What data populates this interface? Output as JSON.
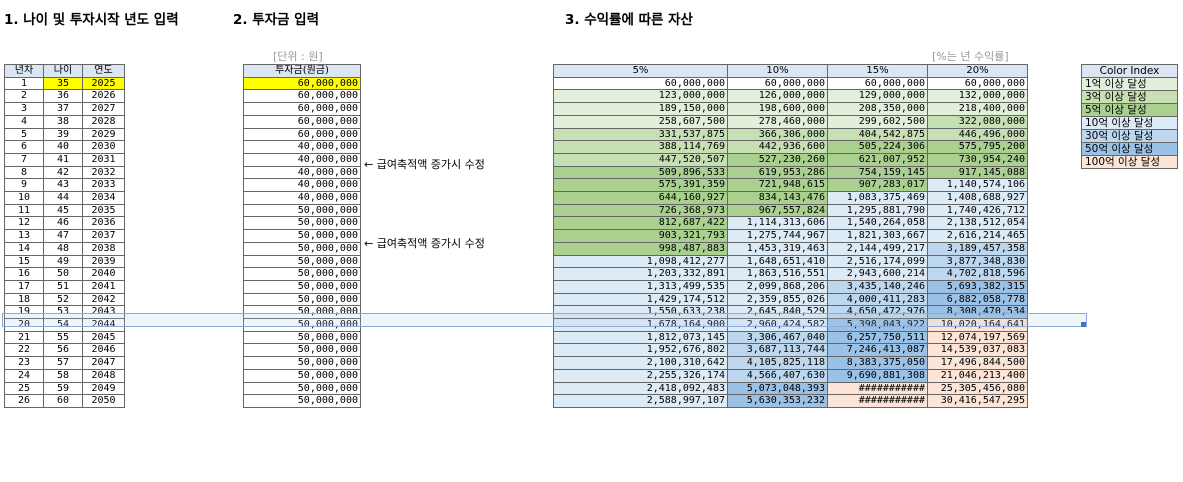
{
  "titles": {
    "section1": "1. 나이 및 투자시작 년도 입력",
    "section2": "2. 투자금 입력",
    "section3": "3. 수익률에 따른 자산"
  },
  "notes": {
    "unit": "[단위 : 원]",
    "rate_note": "[%는 년 수익률]"
  },
  "annotations": [
    "← 급여축적액 증가시 수정",
    "← 급여축적액 증가시 수정"
  ],
  "left_table": {
    "headers": [
      "년차",
      "나이",
      "연도"
    ],
    "rows": [
      [
        "1",
        "35",
        "2025"
      ],
      [
        "2",
        "36",
        "2026"
      ],
      [
        "3",
        "37",
        "2027"
      ],
      [
        "4",
        "38",
        "2028"
      ],
      [
        "5",
        "39",
        "2029"
      ],
      [
        "6",
        "40",
        "2030"
      ],
      [
        "7",
        "41",
        "2031"
      ],
      [
        "8",
        "42",
        "2032"
      ],
      [
        "9",
        "43",
        "2033"
      ],
      [
        "10",
        "44",
        "2034"
      ],
      [
        "11",
        "45",
        "2035"
      ],
      [
        "12",
        "46",
        "2036"
      ],
      [
        "13",
        "47",
        "2037"
      ],
      [
        "14",
        "48",
        "2038"
      ],
      [
        "15",
        "49",
        "2039"
      ],
      [
        "16",
        "50",
        "2040"
      ],
      [
        "17",
        "51",
        "2041"
      ],
      [
        "18",
        "52",
        "2042"
      ],
      [
        "19",
        "53",
        "2043"
      ],
      [
        "20",
        "54",
        "2044"
      ],
      [
        "21",
        "55",
        "2045"
      ],
      [
        "22",
        "56",
        "2046"
      ],
      [
        "23",
        "57",
        "2047"
      ],
      [
        "24",
        "58",
        "2048"
      ],
      [
        "25",
        "59",
        "2049"
      ],
      [
        "26",
        "60",
        "2050"
      ]
    ]
  },
  "invest_table": {
    "header": "투자금(원금)",
    "values": [
      "60,000,000",
      "60,000,000",
      "60,000,000",
      "60,000,000",
      "60,000,000",
      "40,000,000",
      "40,000,000",
      "40,000,000",
      "40,000,000",
      "40,000,000",
      "50,000,000",
      "50,000,000",
      "50,000,000",
      "50,000,000",
      "50,000,000",
      "50,000,000",
      "50,000,000",
      "50,000,000",
      "50,000,000",
      "50,000,000",
      "50,000,000",
      "50,000,000",
      "50,000,000",
      "50,000,000",
      "50,000,000",
      "50,000,000"
    ]
  },
  "return_table": {
    "headers": [
      "5%",
      "10%",
      "15%",
      "20%"
    ],
    "rows": [
      [
        "60,000,000",
        "60,000,000",
        "60,000,000",
        "60,000,000"
      ],
      [
        "123,000,000",
        "126,000,000",
        "129,000,000",
        "132,000,000"
      ],
      [
        "189,150,000",
        "198,600,000",
        "208,350,000",
        "218,400,000"
      ],
      [
        "258,607,500",
        "278,460,000",
        "299,602,500",
        "322,080,000"
      ],
      [
        "331,537,875",
        "366,306,000",
        "404,542,875",
        "446,496,000"
      ],
      [
        "388,114,769",
        "442,936,600",
        "505,224,306",
        "575,795,200"
      ],
      [
        "447,520,507",
        "527,230,260",
        "621,007,952",
        "730,954,240"
      ],
      [
        "509,896,533",
        "619,953,286",
        "754,159,145",
        "917,145,088"
      ],
      [
        "575,391,359",
        "721,948,615",
        "907,283,017",
        "1,140,574,106"
      ],
      [
        "644,160,927",
        "834,143,476",
        "1,083,375,469",
        "1,408,688,927"
      ],
      [
        "726,368,973",
        "967,557,824",
        "1,295,881,790",
        "1,740,426,712"
      ],
      [
        "812,687,422",
        "1,114,313,606",
        "1,540,264,058",
        "2,138,512,054"
      ],
      [
        "903,321,793",
        "1,275,744,967",
        "1,821,303,667",
        "2,616,214,465"
      ],
      [
        "998,487,883",
        "1,453,319,463",
        "2,144,499,217",
        "3,189,457,358"
      ],
      [
        "1,098,412,277",
        "1,648,651,410",
        "2,516,174,099",
        "3,877,348,830"
      ],
      [
        "1,203,332,891",
        "1,863,516,551",
        "2,943,600,214",
        "4,702,818,596"
      ],
      [
        "1,313,499,535",
        "2,099,868,206",
        "3,435,140,246",
        "5,693,382,315"
      ],
      [
        "1,429,174,512",
        "2,359,855,026",
        "4,000,411,283",
        "6,882,058,778"
      ],
      [
        "1,550,633,238",
        "2,645,840,529",
        "4,650,472,976",
        "8,308,470,534"
      ],
      [
        "1,678,164,900",
        "2,960,424,582",
        "5,398,043,922",
        "10,020,164,641"
      ],
      [
        "1,812,073,145",
        "3,306,467,040",
        "6,257,750,511",
        "12,074,197,569"
      ],
      [
        "1,952,676,802",
        "3,687,113,744",
        "7,246,413,087",
        "14,539,037,083"
      ],
      [
        "2,100,310,642",
        "4,105,825,118",
        "8,383,375,050",
        "17,496,844,500"
      ],
      [
        "2,255,326,174",
        "4,566,407,630",
        "9,690,881,308",
        "21,046,213,400"
      ],
      [
        "2,418,092,483",
        "5,073,048,393",
        "###########",
        "25,305,456,080"
      ],
      [
        "2,588,997,107",
        "5,630,353,232",
        "###########",
        "30,416,547,295"
      ]
    ]
  },
  "legend": {
    "header": "Color Index",
    "items": [
      "1억 이상 달성",
      "3억 이상 달성",
      "5억 이상 달성",
      "10억 이상 달성",
      "30억 이상 달성",
      "50억 이상 달성",
      "100억 이상 달성"
    ]
  },
  "colors": {
    "header_bg": "#dbe5f3",
    "highlight": "#ffff00",
    "under_1": "#ffffff",
    "eok_1": "#e2efda",
    "eok_3": "#c6e0b4",
    "eok_5": "#a9d08e",
    "eok_10": "#ddebf7",
    "eok_30": "#bdd7ee",
    "eok_50": "#9bc2e6",
    "eok_100": "#fce4d6"
  }
}
